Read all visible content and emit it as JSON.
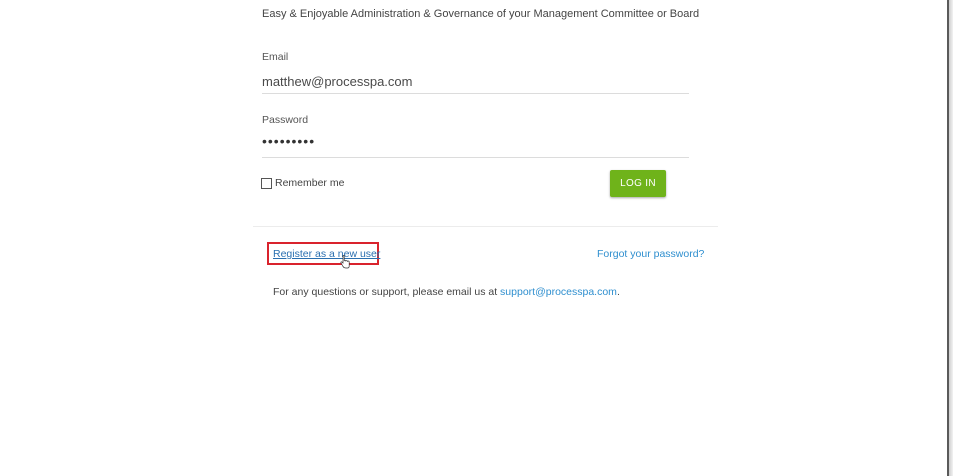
{
  "tagline": "Easy & Enjoyable Administration & Governance of your Management Committee or Board",
  "login_form": {
    "email_label": "Email",
    "email_value": "matthew@processpa.com",
    "password_label": "Password",
    "password_value": "•••••••••",
    "remember_label": "Remember me",
    "remember_checked": false,
    "login_button_label": "LOG IN"
  },
  "links": {
    "register_label": "Register as a new user",
    "forgot_label": "Forgot your password?"
  },
  "support": {
    "text": "For any questions or support, please email us at ",
    "email": "support@processpa.com",
    "end": "."
  },
  "colors": {
    "login_button": "#6fb31a",
    "link": "#2f8fcf",
    "highlight_box": "#d9232d"
  },
  "icons": {
    "cursor": "hand-pointer-icon"
  }
}
